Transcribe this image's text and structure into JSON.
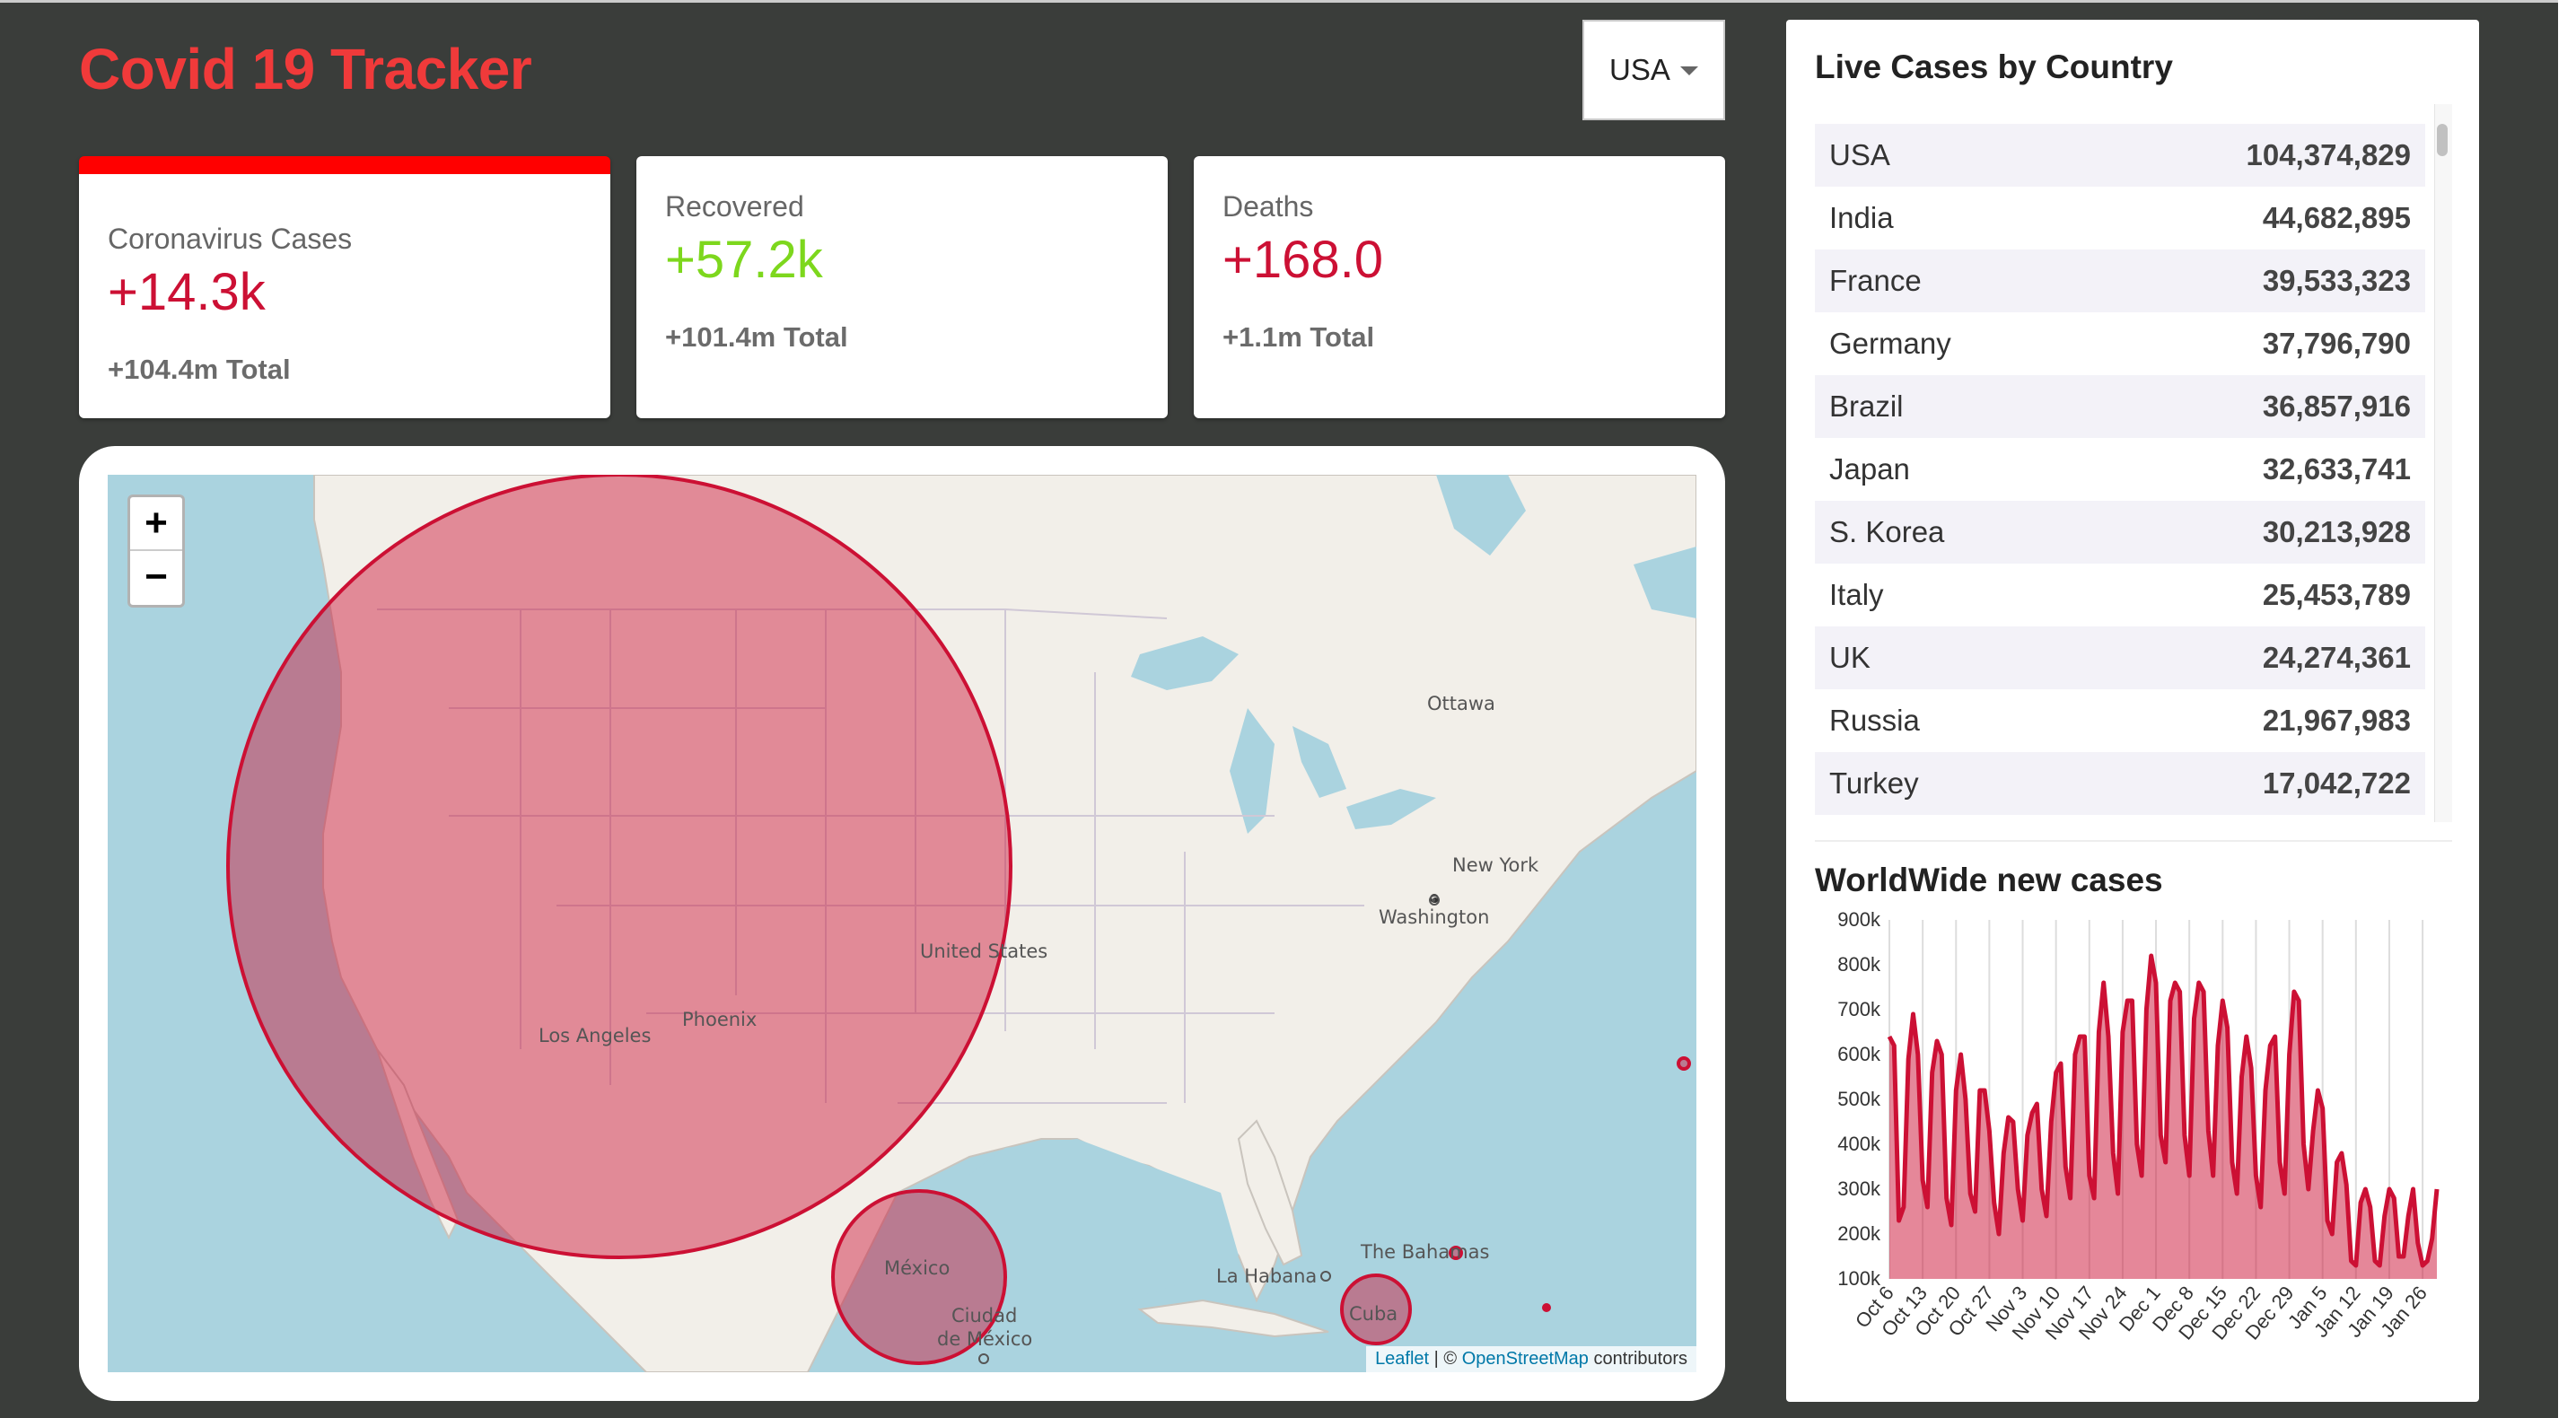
{
  "header": {
    "title": "Covid 19 Tracker"
  },
  "country_select": {
    "value": "USA"
  },
  "cards": [
    {
      "title": "Coronavirus Cases",
      "value": "+14.3k",
      "total": "+104.4m Total",
      "selected": true
    },
    {
      "title": "Recovered",
      "value": "+57.2k",
      "total": "+101.4m Total",
      "selected": false
    },
    {
      "title": "Deaths",
      "value": "+168.0",
      "total": "+1.1m Total",
      "selected": false
    }
  ],
  "map": {
    "zoom_in": "+",
    "zoom_out": "−",
    "labels": {
      "ottawa": "Ottawa",
      "new_york": "New York",
      "washington": "Washington",
      "united_states": "United States",
      "phoenix": "Phoenix",
      "los_angeles": "Los Angeles",
      "mexico": "México",
      "ciudad": "Ciudad",
      "de_mexico": "de México",
      "la_habana": "La Habana",
      "bahamas": "The Bahamas",
      "cuba": "Cuba"
    },
    "attribution": {
      "leaflet": "Leaflet",
      "sep": " | © ",
      "osm": "OpenStreetMap",
      "suffix": " contributors"
    }
  },
  "live_cases": {
    "title": "Live Cases by Country",
    "rows": [
      {
        "country": "USA",
        "cases": "104,374,829"
      },
      {
        "country": "India",
        "cases": "44,682,895"
      },
      {
        "country": "France",
        "cases": "39,533,323"
      },
      {
        "country": "Germany",
        "cases": "37,796,790"
      },
      {
        "country": "Brazil",
        "cases": "36,857,916"
      },
      {
        "country": "Japan",
        "cases": "32,633,741"
      },
      {
        "country": "S. Korea",
        "cases": "30,213,928"
      },
      {
        "country": "Italy",
        "cases": "25,453,789"
      },
      {
        "country": "UK",
        "cases": "24,274,361"
      },
      {
        "country": "Russia",
        "cases": "21,967,983"
      },
      {
        "country": "Turkey",
        "cases": "17,042,722"
      }
    ]
  },
  "worldwide": {
    "title": "WorldWide new cases"
  },
  "chart_data": {
    "type": "area",
    "title": "WorldWide new cases",
    "xlabel": "",
    "ylabel": "",
    "y_ticks": [
      "100k",
      "200k",
      "300k",
      "400k",
      "500k",
      "600k",
      "700k",
      "800k",
      "900k"
    ],
    "ylim": [
      100000,
      900000
    ],
    "x_ticks": [
      "Oct 6",
      "Oct 13",
      "Oct 20",
      "Oct 27",
      "Nov 3",
      "Nov 10",
      "Nov 17",
      "Nov 24",
      "Dec 1",
      "Dec 8",
      "Dec 15",
      "Dec 22",
      "Dec 29",
      "Jan 5",
      "Jan 12",
      "Jan 19",
      "Jan 26"
    ],
    "x_tick_day": [
      0,
      7,
      14,
      21,
      28,
      35,
      42,
      49,
      56,
      63,
      70,
      77,
      84,
      91,
      98,
      105,
      112
    ],
    "values": [
      640000,
      620000,
      230000,
      260000,
      590000,
      690000,
      600000,
      320000,
      260000,
      560000,
      630000,
      600000,
      280000,
      220000,
      520000,
      600000,
      500000,
      290000,
      250000,
      520000,
      520000,
      430000,
      270000,
      200000,
      380000,
      460000,
      450000,
      300000,
      230000,
      420000,
      470000,
      490000,
      300000,
      240000,
      450000,
      560000,
      580000,
      350000,
      280000,
      600000,
      640000,
      640000,
      330000,
      280000,
      650000,
      760000,
      640000,
      380000,
      290000,
      650000,
      720000,
      720000,
      400000,
      330000,
      700000,
      820000,
      760000,
      420000,
      360000,
      720000,
      760000,
      740000,
      420000,
      330000,
      680000,
      760000,
      740000,
      430000,
      330000,
      620000,
      720000,
      660000,
      360000,
      290000,
      550000,
      640000,
      570000,
      330000,
      260000,
      520000,
      620000,
      640000,
      360000,
      290000,
      600000,
      740000,
      720000,
      400000,
      300000,
      430000,
      520000,
      480000,
      230000,
      200000,
      360000,
      380000,
      310000,
      140000,
      130000,
      270000,
      300000,
      260000,
      140000,
      130000,
      240000,
      300000,
      280000,
      150000,
      150000,
      240000,
      300000,
      180000,
      130000,
      140000,
      190000,
      300000
    ]
  }
}
